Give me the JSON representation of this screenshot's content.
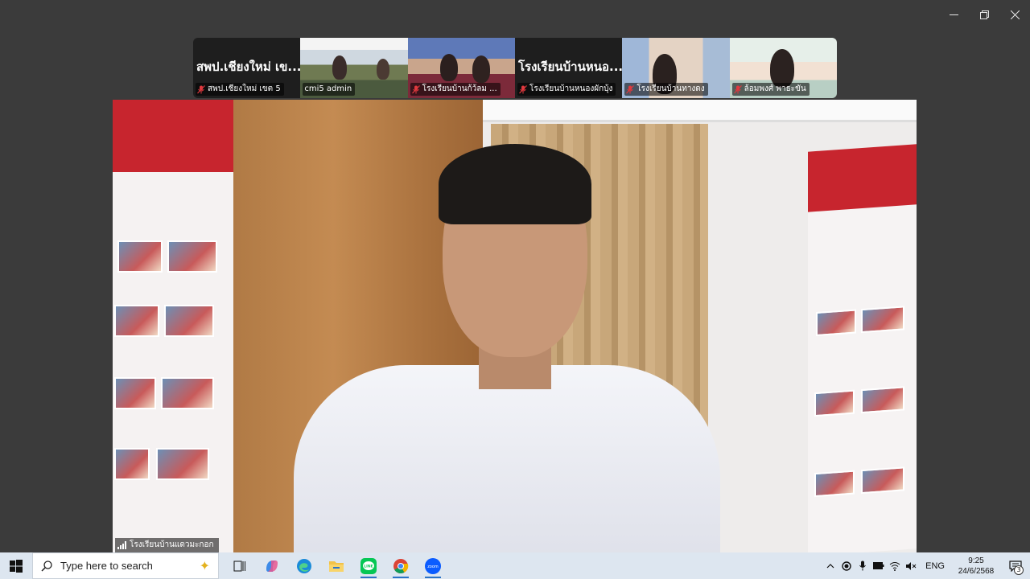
{
  "window": {
    "controls": [
      "minimize",
      "restore",
      "close"
    ]
  },
  "participants": [
    {
      "display_text": "สพป.เชียงใหม่ เข...",
      "label": "สพป.เชียงใหม่ เขต 5",
      "muted": true,
      "video": false
    },
    {
      "display_text": "",
      "label": "cmi5 admin",
      "muted": false,
      "video": true
    },
    {
      "display_text": "",
      "label": "โรงเรียนบ้านก้ว้ลม ...",
      "muted": true,
      "video": true
    },
    {
      "display_text": "โรงเรียนบ้านหนอ...",
      "label": "โรงเรียนบ้านหนองผักบุ้ง",
      "muted": true,
      "video": false
    },
    {
      "display_text": "",
      "label": "โรงเรียนบ้านทางดง",
      "muted": true,
      "video": true
    },
    {
      "display_text": "",
      "label": "ล้อมพงศ์ พาธะขัน",
      "muted": true,
      "video": true
    }
  ],
  "active_speaker": {
    "label": "โรงเรียนบ้านแดวมะกอก"
  },
  "taskbar": {
    "search_placeholder": "Type here to search",
    "apps": [
      "task-view",
      "copilot",
      "edge",
      "file-explorer",
      "line",
      "chrome",
      "zoom"
    ],
    "active_apps": [
      "line",
      "chrome",
      "zoom"
    ],
    "language": "ENG",
    "time": "9:25",
    "date": "24/6/2568",
    "notification_count": "3"
  },
  "colors": {
    "background": "#3b3b3b",
    "taskbar": "#dde6f0",
    "muted_icon": "#e0393e",
    "active_indicator": "#2b73c7"
  }
}
